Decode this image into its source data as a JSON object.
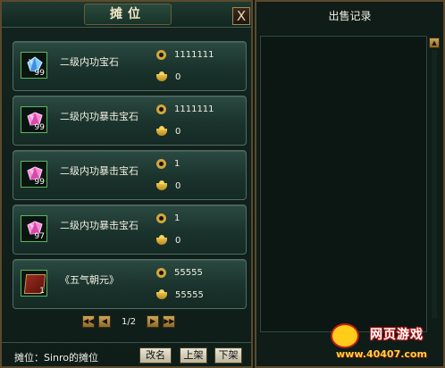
{
  "stall_window": {
    "title": "摊位",
    "close_label": "X",
    "items": [
      {
        "name": "二级内功宝石",
        "quantity": "99",
        "coin_price": "1111111",
        "ingot_price": "0",
        "icon": "blue-gem-icon"
      },
      {
        "name": "二级内功暴击宝石",
        "quantity": "99",
        "coin_price": "1111111",
        "ingot_price": "0",
        "icon": "pink-gem-icon"
      },
      {
        "name": "二级内功暴击宝石",
        "quantity": "99",
        "coin_price": "1",
        "ingot_price": "0",
        "icon": "pink-gem-icon"
      },
      {
        "name": "二级内功暴击宝石",
        "quantity": "97",
        "coin_price": "1",
        "ingot_price": "0",
        "icon": "pink-gem-icon"
      },
      {
        "name": "《五气朝元》",
        "quantity": "1",
        "coin_price": "55555",
        "ingot_price": "55555",
        "icon": "red-book-icon"
      }
    ],
    "pager": {
      "page_text": "1/2"
    },
    "footer": {
      "stall_name": "摊位：Sinro的摊位",
      "rename_label": "改名",
      "list_label": "上架",
      "unlist_label": "下架"
    }
  },
  "record_window": {
    "title": "出售记录"
  },
  "watermark": {
    "brand": "网页游戏",
    "url": "www.40407.com"
  },
  "colors": {
    "panel_bg": "#13231e",
    "slot_bg": "#2b4a41",
    "gold_border": "#5b4a2c",
    "coin": "#d1a73c",
    "item_frame": "#59b860"
  }
}
